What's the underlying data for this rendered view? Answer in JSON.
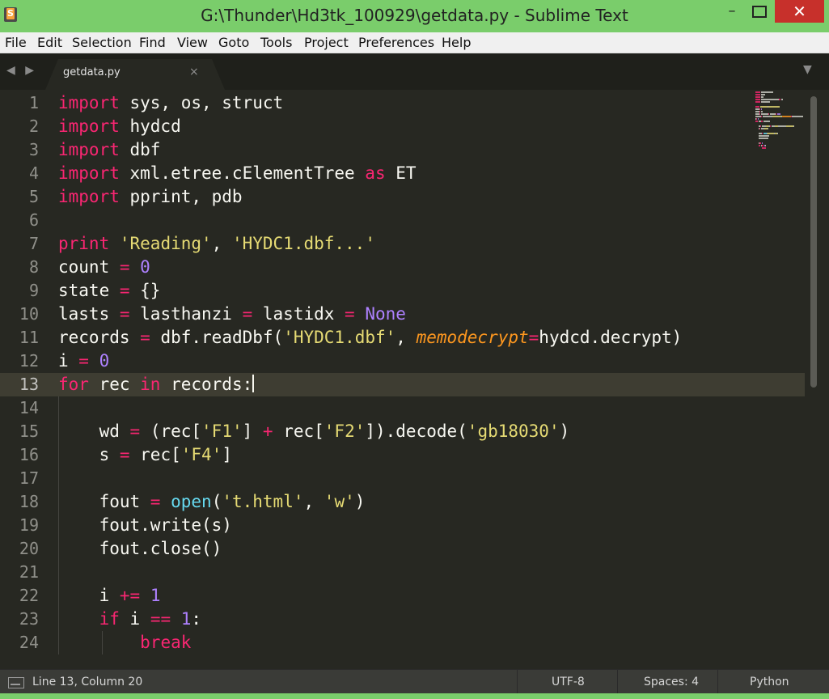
{
  "window": {
    "title": "G:\\Thunder\\Hd3tk_100929\\getdata.py - Sublime Text",
    "frame_color": "#7acd6b",
    "minimize_glyph": "–",
    "close_glyph": "✕"
  },
  "menu": [
    "File",
    "Edit",
    "Selection",
    "Find",
    "View",
    "Goto",
    "Tools",
    "Project",
    "Preferences",
    "Help"
  ],
  "tabs": {
    "nav_arrows": "◀ ▶",
    "items": [
      {
        "label": "getdata.py",
        "close": "×"
      }
    ],
    "dropdown": "▼"
  },
  "editor": {
    "theme_background": "#272822",
    "current_line": 13,
    "lines": [
      {
        "num": "1",
        "tokens": [
          [
            "k",
            "import"
          ],
          [
            "t",
            " sys, os, struct"
          ]
        ]
      },
      {
        "num": "2",
        "tokens": [
          [
            "k",
            "import"
          ],
          [
            "t",
            " hydcd"
          ]
        ]
      },
      {
        "num": "3",
        "tokens": [
          [
            "k",
            "import"
          ],
          [
            "t",
            " dbf"
          ]
        ]
      },
      {
        "num": "4",
        "tokens": [
          [
            "k",
            "import"
          ],
          [
            "t",
            " xml.etree.cElementTree "
          ],
          [
            "k",
            "as"
          ],
          [
            "t",
            " ET"
          ]
        ]
      },
      {
        "num": "5",
        "tokens": [
          [
            "k",
            "import"
          ],
          [
            "t",
            " pprint, pdb"
          ]
        ]
      },
      {
        "num": "6",
        "tokens": []
      },
      {
        "num": "7",
        "tokens": [
          [
            "k",
            "print"
          ],
          [
            "t",
            " "
          ],
          [
            "s",
            "'Reading'"
          ],
          [
            "t",
            ", "
          ],
          [
            "s",
            "'HYDC1.dbf...'"
          ]
        ]
      },
      {
        "num": "8",
        "tokens": [
          [
            "t",
            "count "
          ],
          [
            "k",
            "="
          ],
          [
            "t",
            " "
          ],
          [
            "n",
            "0"
          ]
        ]
      },
      {
        "num": "9",
        "tokens": [
          [
            "t",
            "state "
          ],
          [
            "k",
            "="
          ],
          [
            "t",
            " {}"
          ]
        ]
      },
      {
        "num": "10",
        "tokens": [
          [
            "t",
            "lasts "
          ],
          [
            "k",
            "="
          ],
          [
            "t",
            " lasthanzi "
          ],
          [
            "k",
            "="
          ],
          [
            "t",
            " lastidx "
          ],
          [
            "k",
            "="
          ],
          [
            "t",
            " "
          ],
          [
            "n",
            "None"
          ]
        ]
      },
      {
        "num": "11",
        "tokens": [
          [
            "t",
            "records "
          ],
          [
            "k",
            "="
          ],
          [
            "t",
            " dbf.readDbf("
          ],
          [
            "s",
            "'HYDC1.dbf'"
          ],
          [
            "t",
            ", "
          ],
          [
            "a",
            "memodecrypt"
          ],
          [
            "k",
            "="
          ],
          [
            "t",
            "hydcd.decrypt)"
          ]
        ]
      },
      {
        "num": "12",
        "tokens": [
          [
            "t",
            "i "
          ],
          [
            "k",
            "="
          ],
          [
            "t",
            " "
          ],
          [
            "n",
            "0"
          ]
        ]
      },
      {
        "num": "13",
        "tokens": [
          [
            "k",
            "for"
          ],
          [
            "t",
            " rec "
          ],
          [
            "k",
            "in"
          ],
          [
            "t",
            " records:"
          ],
          [
            "c",
            ""
          ]
        ]
      },
      {
        "num": "14",
        "tokens": []
      },
      {
        "num": "15",
        "tokens": [
          [
            "t",
            "    wd "
          ],
          [
            "k",
            "="
          ],
          [
            "t",
            " (rec["
          ],
          [
            "s",
            "'F1'"
          ],
          [
            "t",
            "] "
          ],
          [
            "k",
            "+"
          ],
          [
            "t",
            " rec["
          ],
          [
            "s",
            "'F2'"
          ],
          [
            "t",
            "]).decode("
          ],
          [
            "s",
            "'gb18030'"
          ],
          [
            "t",
            ")"
          ]
        ]
      },
      {
        "num": "16",
        "tokens": [
          [
            "t",
            "    s "
          ],
          [
            "k",
            "="
          ],
          [
            "t",
            " rec["
          ],
          [
            "s",
            "'F4'"
          ],
          [
            "t",
            "]"
          ]
        ]
      },
      {
        "num": "17",
        "tokens": []
      },
      {
        "num": "18",
        "tokens": [
          [
            "t",
            "    fout "
          ],
          [
            "k",
            "="
          ],
          [
            "t",
            " "
          ],
          [
            "b",
            "open"
          ],
          [
            "t",
            "("
          ],
          [
            "s",
            "'t.html'"
          ],
          [
            "t",
            ", "
          ],
          [
            "s",
            "'w'"
          ],
          [
            "t",
            ")"
          ]
        ]
      },
      {
        "num": "19",
        "tokens": [
          [
            "t",
            "    fout.write(s)"
          ]
        ]
      },
      {
        "num": "20",
        "tokens": [
          [
            "t",
            "    fout.close()"
          ]
        ]
      },
      {
        "num": "21",
        "tokens": []
      },
      {
        "num": "22",
        "tokens": [
          [
            "t",
            "    i "
          ],
          [
            "k",
            "+="
          ],
          [
            "t",
            " "
          ],
          [
            "n",
            "1"
          ]
        ]
      },
      {
        "num": "23",
        "tokens": [
          [
            "t",
            "    "
          ],
          [
            "k",
            "if"
          ],
          [
            "t",
            " i "
          ],
          [
            "k",
            "=="
          ],
          [
            "t",
            " "
          ],
          [
            "n",
            "1"
          ],
          [
            "t",
            ":"
          ]
        ]
      },
      {
        "num": "24",
        "tokens": [
          [
            "t",
            "        "
          ],
          [
            "k",
            "break"
          ]
        ]
      }
    ]
  },
  "statusbar": {
    "position": "Line 13, Column 20",
    "encoding": "UTF-8",
    "indentation": "Spaces: 4",
    "syntax": "Python"
  }
}
